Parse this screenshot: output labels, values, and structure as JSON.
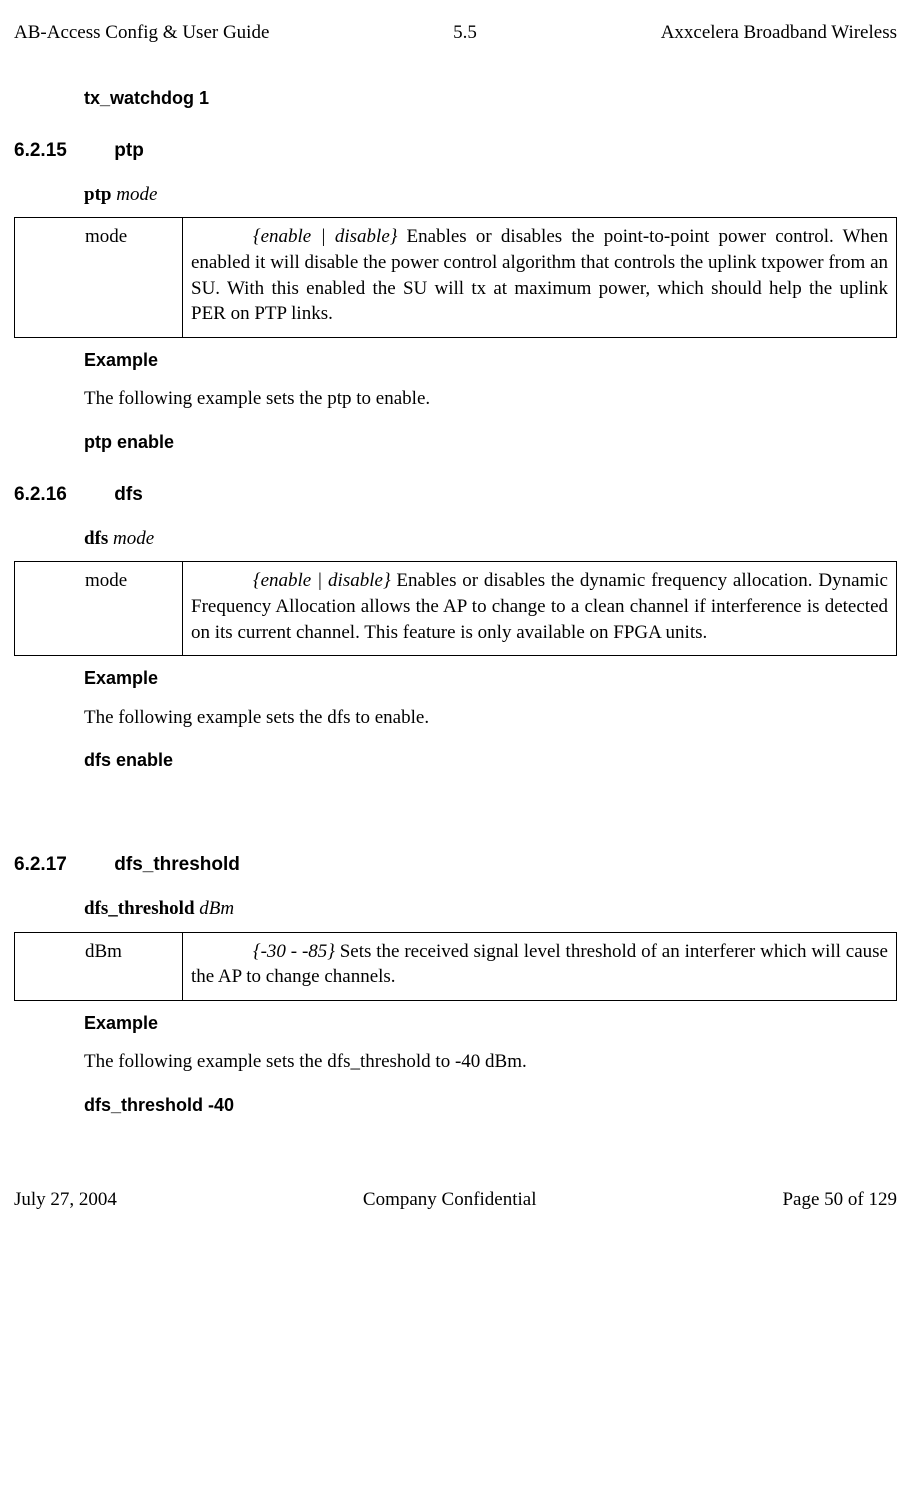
{
  "header": {
    "left": "AB-Access Config & User Guide",
    "center": "5.5",
    "right": "Axxcelera Broadband Wireless"
  },
  "footer": {
    "left": "July 27, 2004",
    "center": "Company Confidential",
    "right": "Page 50 of 129"
  },
  "prev_example_cmd": "tx_watchdog 1",
  "sections": {
    "ptp": {
      "num": "6.2.15",
      "title": "ptp",
      "syntax_kw": "ptp",
      "syntax_arg": "mode",
      "param_key": "mode",
      "param_opt": "{enable | disable}",
      "param_desc": " Enables or disables the point-to-point power control. When enabled it will disable the power control algorithm that controls the uplink txpower from an SU. With this enabled the SU will tx at maximum power, which should help the uplink PER on PTP links.",
      "example_label": "Example",
      "example_text": "The following example sets the ptp to enable.",
      "example_cmd": "ptp enable"
    },
    "dfs": {
      "num": "6.2.16",
      "title": "dfs",
      "syntax_kw": "dfs",
      "syntax_arg": "mode",
      "param_key": "mode",
      "param_opt": "{enable | disable}",
      "param_desc": " Enables or disables the dynamic frequency allocation. Dynamic Frequency Allocation allows the AP to change to a clean channel if interference is detected on its current channel. This feature is only available on FPGA units.",
      "example_label": "Example",
      "example_text": "The following example sets the dfs to enable.",
      "example_cmd": "dfs enable"
    },
    "dfs_threshold": {
      "num": "6.2.17",
      "title": "dfs_threshold",
      "syntax_kw": "dfs_threshold",
      "syntax_arg": "dBm",
      "param_key": "dBm",
      "param_opt": "{-30 - -85}",
      "param_desc": " Sets the received signal level threshold of an interferer which will cause the AP to change channels.",
      "example_label": "Example",
      "example_text": "The following example sets the dfs_threshold to -40 dBm.",
      "example_cmd": "dfs_threshold -40"
    }
  }
}
